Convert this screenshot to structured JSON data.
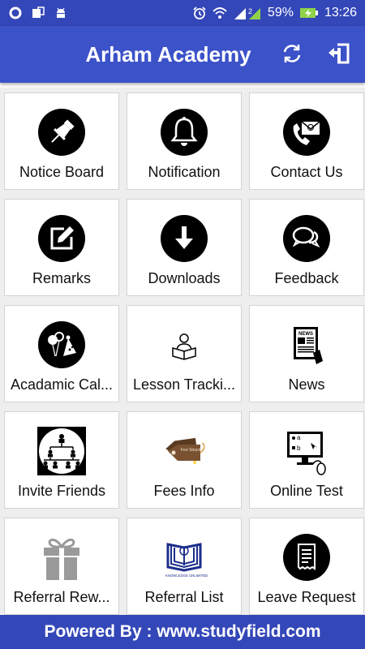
{
  "status_bar": {
    "battery": "59%",
    "time": "13:26",
    "sim1": "1",
    "sim2": "2",
    "icons": [
      "circle-icon",
      "sim-card-icon",
      "android-icon",
      "alarm-icon",
      "wifi-icon",
      "signal-icon",
      "battery-charging-icon"
    ]
  },
  "app_bar": {
    "title": "Arham Academy",
    "refresh_icon": "refresh-icon",
    "logout_icon": "logout-icon"
  },
  "menu": [
    {
      "label": "Notice Board",
      "icon": "pin-icon"
    },
    {
      "label": "Notification",
      "icon": "bell-icon"
    },
    {
      "label": "Contact Us",
      "icon": "contact-phone-mail-icon"
    },
    {
      "label": "Remarks",
      "icon": "edit-icon"
    },
    {
      "label": "Downloads",
      "icon": "download-icon"
    },
    {
      "label": "Feedback",
      "icon": "chat-bubbles-icon"
    },
    {
      "label": "Acadamic Cal...",
      "icon": "party-calendar-icon"
    },
    {
      "label": "Lesson Tracki...",
      "icon": "reader-icon"
    },
    {
      "label": "News",
      "icon": "newspaper-icon"
    },
    {
      "label": "Invite Friends",
      "icon": "network-icon"
    },
    {
      "label": "Fees Info",
      "icon": "fees-tag-icon"
    },
    {
      "label": "Online Test",
      "icon": "monitor-test-icon"
    },
    {
      "label": "Referral Rew...",
      "icon": "gift-icon"
    },
    {
      "label": "Referral List",
      "icon": "book-emblem-icon"
    },
    {
      "label": "Leave Request",
      "icon": "receipt-icon"
    }
  ],
  "footer": {
    "text": "Powered By : www.studyfield.com"
  },
  "icon_texts": {
    "news": "NEWS",
    "fees": "Fee Structure",
    "test_a": "a",
    "test_b": "b",
    "knowledge": "KNOWLEDGE UNLIMITED"
  },
  "colors": {
    "status_bar": "#3447b8",
    "app_bar": "#3c52c9",
    "tile_bg": "#ffffff",
    "grid_bg": "#eeeeee"
  }
}
